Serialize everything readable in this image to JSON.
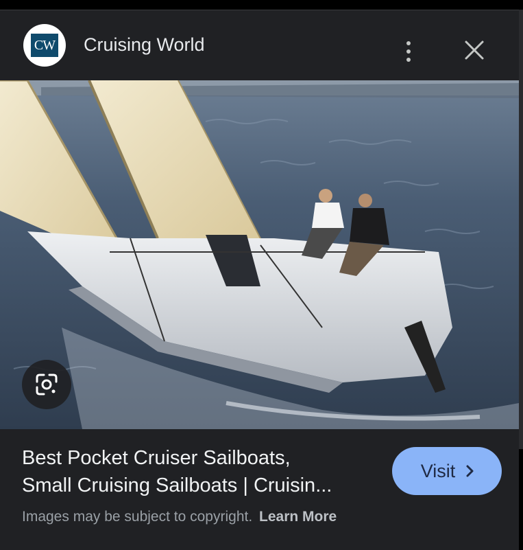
{
  "header": {
    "logo_text": "CW",
    "site_name": "Cruising World",
    "more_icon": "more-vert-icon",
    "close_icon": "close-icon"
  },
  "image": {
    "description_icon": "sailboat-photo",
    "lens_icon": "google-lens-icon"
  },
  "result": {
    "title_line1": "Best Pocket Cruiser Sailboats,",
    "title_line2": "Small Cruising Sailboats | Cruisin...",
    "visit_label": "Visit",
    "visit_icon": "chevron-right-icon",
    "copyright_text": "Images may be subject to copyright.",
    "learn_more": "Learn More"
  },
  "colors": {
    "background": "#202124",
    "accent": "#8ab4f8",
    "logo_blue": "#0f4a6c"
  }
}
